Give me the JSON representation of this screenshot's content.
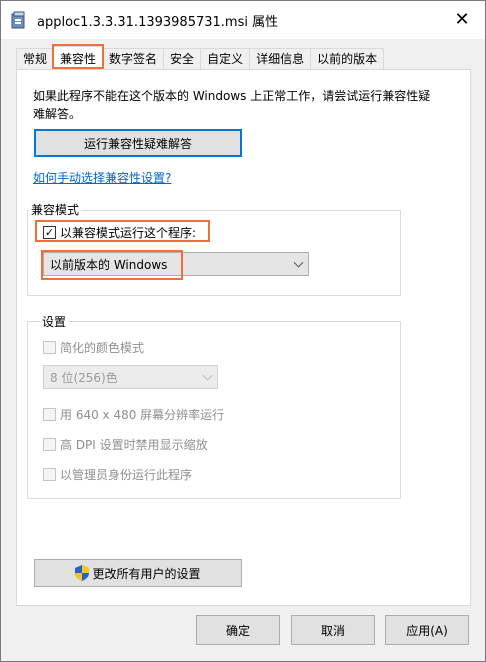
{
  "window": {
    "title": "apploc1.3.3.31.1393985731.msi 属性",
    "close_label": "✕"
  },
  "tabs": [
    {
      "label": "常规",
      "active": false
    },
    {
      "label": "兼容性",
      "active": true
    },
    {
      "label": "数字签名",
      "active": false
    },
    {
      "label": "安全",
      "active": false
    },
    {
      "label": "自定义",
      "active": false
    },
    {
      "label": "详细信息",
      "active": false
    },
    {
      "label": "以前的版本",
      "active": false
    }
  ],
  "compat": {
    "description": "如果此程序不能在这个版本的 Windows 上正常工作，请尝试运行兼容性疑难解答。",
    "troubleshoot_button": "运行兼容性疑难解答",
    "manual_link": "如何手动选择兼容性设置?"
  },
  "compat_mode": {
    "legend": "兼容模式",
    "checkbox_label": "以兼容模式运行这个程序:",
    "checked": true,
    "check_glyph": "✓",
    "selected_os": "以前版本的 Windows"
  },
  "settings": {
    "legend": "设置",
    "reduced_color_label": "简化的颜色模式",
    "color_depth_value": "8 位(256)色",
    "resolution_label": "用 640 x 480 屏幕分辨率运行",
    "dpi_label": "高 DPI 设置时禁用显示缩放",
    "admin_label": "以管理员身份运行此程序"
  },
  "change_all_button": "更改所有用户的设置",
  "footer": {
    "ok": "确定",
    "cancel": "取消",
    "apply": "应用(A)"
  },
  "colors": {
    "highlight": "#f26f3b",
    "link": "#0066cc",
    "focus": "#0078d7"
  }
}
